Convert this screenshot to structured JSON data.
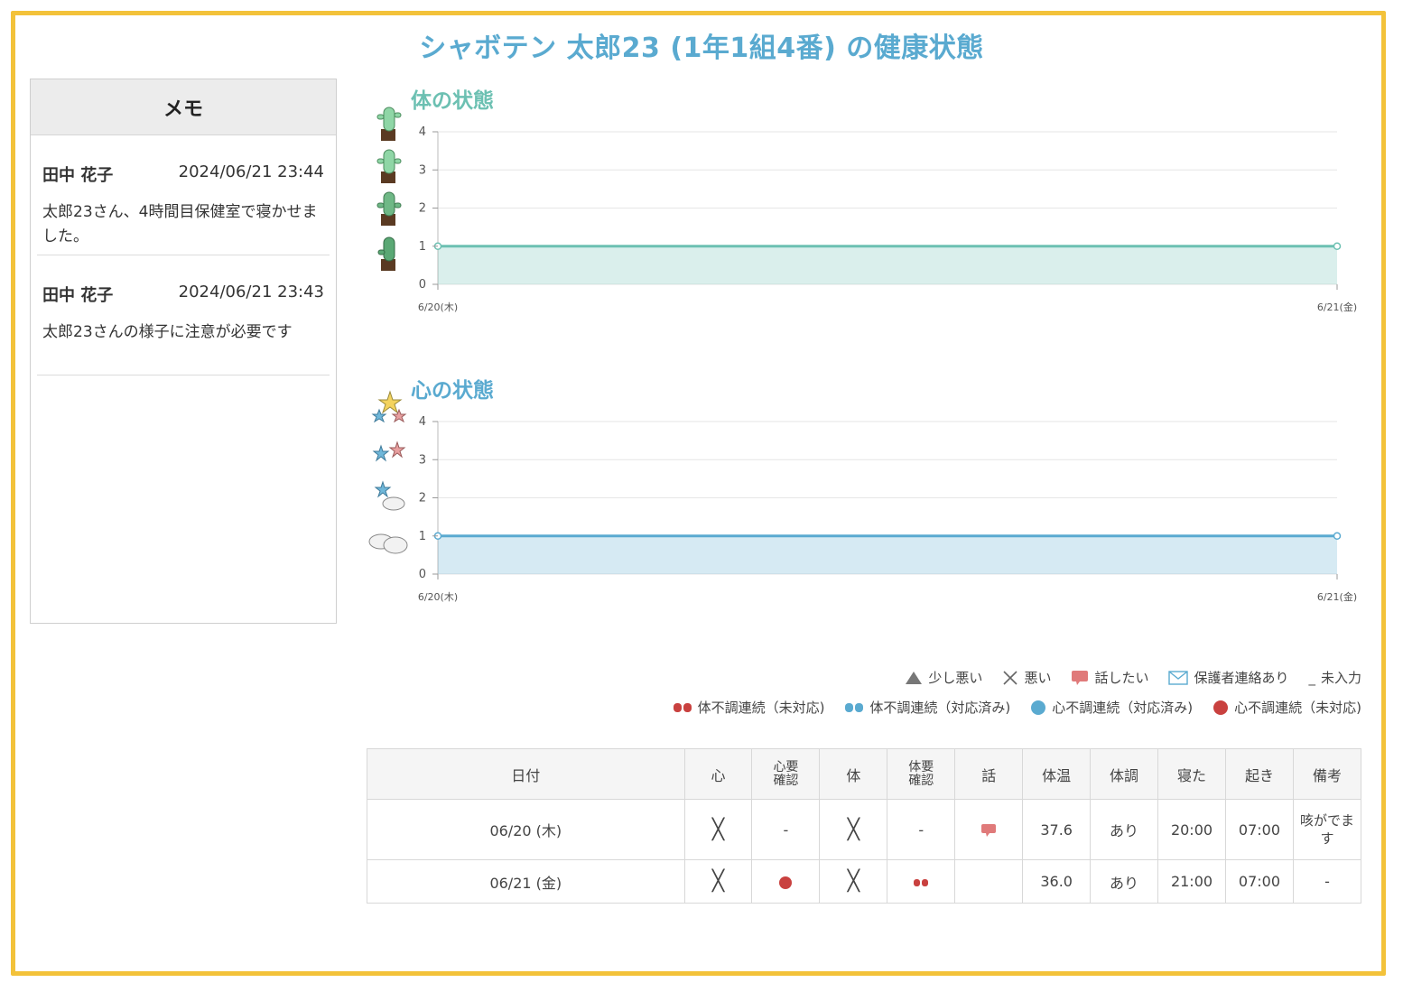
{
  "page": {
    "title": "シャボテン 太郎23 (1年1組4番) の健康状態"
  },
  "memo": {
    "header": "メモ",
    "items": [
      {
        "author": "田中 花子",
        "datetime": "2024/06/21 23:44",
        "text": "太郎23さん、4時間目保健室で寝かせました。"
      },
      {
        "author": "田中 花子",
        "datetime": "2024/06/21 23:43",
        "text": "太郎23さんの様子に注意が必要です"
      }
    ]
  },
  "chart_data": [
    {
      "type": "area",
      "title": "体の状態",
      "categories": [
        "6/20(木)",
        "6/21(金)"
      ],
      "values": [
        1,
        1
      ],
      "y_ticks": [
        "0",
        "1",
        "2",
        "3",
        "4"
      ],
      "ylim": [
        0,
        4
      ],
      "color": "#6cc0b2",
      "grid": true
    },
    {
      "type": "area",
      "title": "心の状態",
      "categories": [
        "6/20(木)",
        "6/21(金)"
      ],
      "values": [
        1,
        1
      ],
      "y_ticks": [
        "0",
        "1",
        "2",
        "3",
        "4"
      ],
      "ylim": [
        0,
        4
      ],
      "color": "#5aaad0",
      "grid": true
    }
  ],
  "legend": {
    "row1": [
      {
        "icon": "triangle-icon",
        "label": "少し悪い"
      },
      {
        "icon": "x-icon",
        "label": "悪い"
      },
      {
        "icon": "speech-bubble-icon",
        "label": "話したい"
      },
      {
        "icon": "envelope-icon",
        "label": "保護者連絡あり"
      },
      {
        "icon": "underscore-icon",
        "label": "未入力"
      }
    ],
    "row2": [
      {
        "icon": "red-pill-icon",
        "label": "体不調連続（未対応)"
      },
      {
        "icon": "blue-pill-icon",
        "label": "体不調連続（対応済み)"
      },
      {
        "icon": "blue-dot-icon",
        "label": "心不調連続（対応済み)"
      },
      {
        "icon": "red-dot-icon",
        "label": "心不調連続（未対応)"
      }
    ]
  },
  "table": {
    "headers": {
      "date": "日付",
      "mind": "心",
      "mind_check": "心要確認",
      "body": "体",
      "body_check": "体要確認",
      "talk": "話",
      "temp": "体温",
      "condition": "体調",
      "sleep": "寝た",
      "wake": "起き",
      "note": "備考"
    },
    "rows": [
      {
        "date": "06/20 (木)",
        "mind": "╳",
        "mind_check": "-",
        "body": "╳",
        "body_check": "-",
        "talk": "speech-bubble-icon",
        "temp": "37.6",
        "condition": "あり",
        "sleep": "20:00",
        "wake": "07:00",
        "note": "咳がでます"
      },
      {
        "date": "06/21 (金)",
        "mind": "╳",
        "mind_check": "red-dot-icon",
        "body": "╳",
        "body_check": "red-pill-icon",
        "talk": "",
        "temp": "36.0",
        "condition": "あり",
        "sleep": "21:00",
        "wake": "07:00",
        "note": "-"
      }
    ]
  },
  "colors": {
    "frame": "#f3c23a",
    "title": "#5aaad0",
    "body_chart": "#6cc0b2",
    "mind_chart": "#5aaad0",
    "alert_red": "#d9534f"
  }
}
